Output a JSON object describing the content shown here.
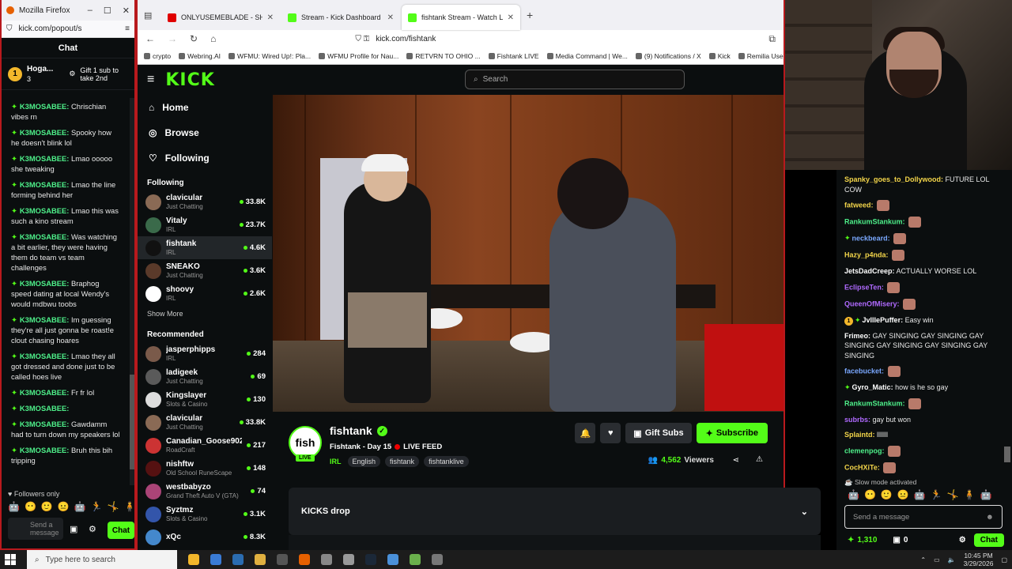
{
  "left_window": {
    "title": "Mozilla Firefox",
    "url": "kick.com/popout/s",
    "chat_header": "Chat",
    "pinned": {
      "rank": "1",
      "name": "Hoga...",
      "count": "3",
      "gift_text": "Gift 1 sub to take 2nd"
    },
    "messages": [
      {
        "name": "K3MOSABEE:",
        "text": "Chrischian vibes rn"
      },
      {
        "name": "K3MOSABEE:",
        "text": "Spooky how he doesn't blink lol"
      },
      {
        "name": "K3MOSABEE:",
        "text": "Lmao ooooo she tweaking"
      },
      {
        "name": "K3MOSABEE:",
        "text": "Lmao the line forming behind her"
      },
      {
        "name": "K3MOSABEE:",
        "text": "Lmao this was such a kino stream"
      },
      {
        "name": "K3MOSABEE:",
        "text": "Was watching a bit earlier, they were having them do team vs team challenges"
      },
      {
        "name": "K3MOSABEE:",
        "text": "Braphog speed dating at local Wendy's would mdbwu toobs"
      },
      {
        "name": "K3MOSABEE:",
        "text": "Im guessing they're all just gonna be roast!e clout chasing hoares"
      },
      {
        "name": "K3MOSABEE:",
        "text": "Lmao they all got dressed and done just to be called hoes live"
      },
      {
        "name": "K3MOSABEE:",
        "text": "Fr fr lol"
      },
      {
        "name": "K3MOSABEE:",
        "text": ""
      },
      {
        "name": "K3MOSABEE:",
        "text": "Gawdamm had to turn down my speakers lol"
      },
      {
        "name": "K3MOSABEE:",
        "text": "Bruh this bih tripping"
      }
    ],
    "followers_only": "Followers only",
    "input_placeholder": "Send a message",
    "chat_button": "Chat"
  },
  "browser": {
    "tabs": [
      {
        "title": "ONLYUSEMEBLADE - SHORT CA",
        "color": "#e00000"
      },
      {
        "title": "Stream - Kick Dashboard",
        "color": "#53fc18"
      },
      {
        "title": "fishtank Stream - Watch Liv",
        "color": "#53fc18"
      }
    ],
    "new_tab": "+",
    "address": "kick.com/fishtank",
    "bookmarks": [
      "crypto",
      "Webring.AI",
      "WFMU: Wired Up!: Pla...",
      "WFMU Profile for Nau...",
      "RETVRN TO OHIO ...",
      "Fishtank LIVE",
      "Media Command | We...",
      "(9) Notifications / X",
      "Kick",
      "Remilia User Profiles"
    ]
  },
  "kick": {
    "logo": "KICK",
    "search_placeholder": "Search",
    "nav": [
      {
        "label": "Home",
        "icon": "home-icon"
      },
      {
        "label": "Browse",
        "icon": "compass-icon"
      },
      {
        "label": "Following",
        "icon": "heart-icon"
      }
    ],
    "following_header": "Following",
    "following": [
      {
        "name": "clavicular",
        "category": "Just Chatting",
        "viewers": "33.8K",
        "color": "#8a6a55"
      },
      {
        "name": "Vitaly",
        "category": "IRL",
        "viewers": "23.7K",
        "color": "#3a6a4a"
      },
      {
        "name": "fishtank",
        "category": "IRL",
        "viewers": "4.6K",
        "color": "#111111"
      },
      {
        "name": "SNEAKO",
        "category": "Just Chatting",
        "viewers": "3.6K",
        "color": "#5a3a2a"
      },
      {
        "name": "shoovy",
        "category": "IRL",
        "viewers": "2.6K",
        "color": "#ffffff"
      }
    ],
    "show_more": "Show More",
    "recommended_header": "Recommended",
    "recommended": [
      {
        "name": "jasperphipps",
        "category": "IRL",
        "viewers": "284",
        "color": "#7a5a4a"
      },
      {
        "name": "ladigeek",
        "category": "Just Chatting",
        "viewers": "69",
        "color": "#5a5a5a"
      },
      {
        "name": "Kingslayer",
        "category": "Slots & Casino",
        "viewers": "130",
        "color": "#dddddd"
      },
      {
        "name": "clavicular",
        "category": "Just Chatting",
        "viewers": "33.8K",
        "color": "#8a6a55"
      },
      {
        "name": "Canadian_Goose902",
        "category": "RoadCraft",
        "viewers": "217",
        "color": "#cc3333"
      },
      {
        "name": "nishftw",
        "category": "Old School RuneScape",
        "viewers": "148",
        "color": "#551111"
      },
      {
        "name": "westbabyzo",
        "category": "Grand Theft Auto V (GTA)",
        "viewers": "74",
        "color": "#aa4477"
      },
      {
        "name": "Syztmz",
        "category": "Slots & Casino",
        "viewers": "3.1K",
        "color": "#3355aa"
      },
      {
        "name": "xQc",
        "category": "",
        "viewers": "8.3K",
        "color": "#4488cc"
      }
    ],
    "stream": {
      "avatar_text": "fish",
      "live_badge": "LIVE",
      "name": "fishtank",
      "title": "Fishtank - Day 15",
      "live_feed": "LIVE FEED",
      "category": "IRL",
      "tags": [
        "English",
        "fishtank",
        "fishtanklive"
      ],
      "gift_subs": "Gift Subs",
      "subscribe": "Subscribe",
      "viewers_count": "4,562",
      "viewers_label": "Viewers",
      "drop_label": "KICKS drop"
    }
  },
  "right_chat": {
    "messages": [
      {
        "name": "Spanky_goes_to_Dollywood:",
        "text": "FUTURE LOL COW",
        "color": "#f3d54a"
      },
      {
        "name": "fatweed:",
        "text": "",
        "color": "#f3d54a",
        "emote": true
      },
      {
        "name": "RankumStankum:",
        "text": "",
        "color": "#4ef08a",
        "emote": true
      },
      {
        "name": "neckbeard:",
        "text": "",
        "color": "#7aa8ff",
        "badge": true,
        "emote": true
      },
      {
        "name": "Hazy_p4nda:",
        "text": "",
        "color": "#f3d54a",
        "emote": true
      },
      {
        "name": "JetsDadCreep:",
        "text": "ACTUALLY WORSE LOL",
        "color": "#ffffff"
      },
      {
        "name": "EclipseTen:",
        "text": "",
        "color": "#b06aff",
        "emote": true
      },
      {
        "name": "QueenOfMisery:",
        "text": "",
        "color": "#b06aff",
        "emote": true
      },
      {
        "name": "JvllIePuffer:",
        "text": "Easy win",
        "color": "#ffffff",
        "rank": "1",
        "badge": true
      },
      {
        "name": "Frimeo:",
        "text": "GAY SINGING GAY SINGING GAY SINGING GAY SINGING GAY SINGING GAY SINGING",
        "color": "#ffffff"
      },
      {
        "name": "facebucket:",
        "text": "",
        "color": "#7aa8ff",
        "emote": true
      },
      {
        "name": "Gyro_Matic:",
        "text": "how is he so gay",
        "color": "#ffffff",
        "badge": true
      },
      {
        "name": "RankumStankum:",
        "text": "",
        "color": "#4ef08a",
        "emote": true
      },
      {
        "name": "subrbs:",
        "text": "gay but won",
        "color": "#b06aff"
      },
      {
        "name": "Splaintd:",
        "text": "lllllll",
        "color": "#f3d54a"
      },
      {
        "name": "clemenpog:",
        "text": "",
        "color": "#4ef08a",
        "emote": true
      },
      {
        "name": "CocHXiTe:",
        "text": "",
        "color": "#f3d54a",
        "emote": true
      }
    ],
    "slow_mode": "Slow mode activated",
    "input_placeholder": "Send a message",
    "kicks": "1,310",
    "gifts": "0",
    "chat_button": "Chat"
  },
  "taskbar": {
    "search_placeholder": "Type here to search",
    "time": "10:45 PM",
    "date": "3/29/2026"
  }
}
